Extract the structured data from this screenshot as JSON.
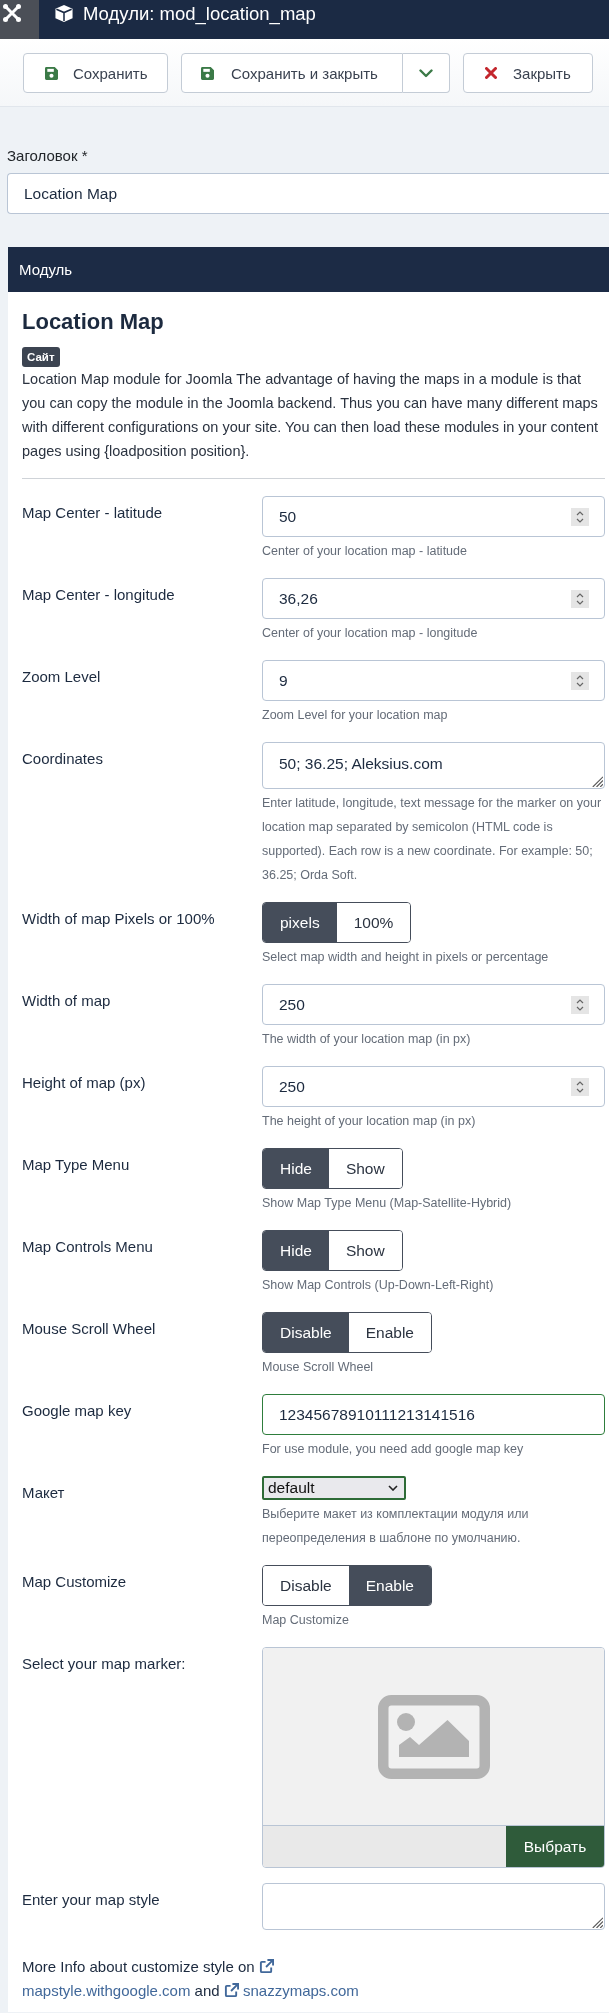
{
  "header": {
    "title": "Модули: mod_location_map"
  },
  "toolbar": {
    "buttons": [
      {
        "kind": "save",
        "label": "Сохранить"
      },
      {
        "kind": "save-split",
        "label": "Сохранить и закрыть"
      },
      {
        "kind": "close",
        "label": "Закрыть"
      }
    ]
  },
  "title_field": {
    "label": "Заголовок *",
    "value": "Location Map"
  },
  "panel": {
    "tabs": [
      {
        "label": "Модуль",
        "selected": true
      }
    ],
    "heading": "Location Map",
    "badge": "Сайт",
    "description": "Location Map module for Joomla The advantage of having the maps in a module is that you can copy the module in the Joomla backend. Thus you can have many different maps with different configurations on your site. You can then load these modules in your content pages using {loadposition position}."
  },
  "fields": [
    {
      "kind": "number",
      "label": "Map Center - latitude",
      "value": "50",
      "valid": false,
      "help": "Center of your location map - latitude"
    },
    {
      "kind": "number",
      "label": "Map Center - longitude",
      "value": "36,26",
      "valid": false,
      "help": "Center of your location map - longitude"
    },
    {
      "kind": "number",
      "label": "Zoom Level",
      "value": "9",
      "valid": false,
      "help": "Zoom Level for your location map"
    },
    {
      "kind": "textarea",
      "label": "Coordinates",
      "value": "50; 36.25; Aleksius.com",
      "valid": false,
      "help": "Enter latitude, longitude, text message for the marker on your location map separated by semicolon (HTML code is supported). Each row is a new coordinate. For example: 50; 36.25; Orda Soft."
    },
    {
      "kind": "toggle",
      "label": "Width of map Pixels or 100%",
      "options": [
        {
          "label": "pixels",
          "selected": true
        },
        {
          "label": "100%",
          "selected": false
        }
      ],
      "help": "Select map width and height in pixels or percentage"
    },
    {
      "kind": "number",
      "label": "Width of map",
      "value": "250",
      "valid": false,
      "help": "The width of your location map (in px)"
    },
    {
      "kind": "number",
      "label": "Height of map (px)",
      "value": "250",
      "valid": false,
      "help": "The height of your location map (in px)"
    },
    {
      "kind": "toggle",
      "label": "Map Type Menu",
      "options": [
        {
          "label": "Hide",
          "selected": true
        },
        {
          "label": "Show",
          "selected": false
        }
      ],
      "help": "Show Map Type Menu (Map-Satellite-Hybrid)"
    },
    {
      "kind": "toggle",
      "label": "Map Controls Menu",
      "options": [
        {
          "label": "Hide",
          "selected": true
        },
        {
          "label": "Show",
          "selected": false
        }
      ],
      "help": "Show Map Controls (Up-Down-Left-Right)"
    },
    {
      "kind": "toggle",
      "label": "Mouse Scroll Wheel",
      "options": [
        {
          "label": "Disable",
          "selected": true
        },
        {
          "label": "Enable",
          "selected": false
        }
      ],
      "help": "Mouse Scroll Wheel"
    },
    {
      "kind": "text",
      "label": "Google map key",
      "value": "12345678910111213141516",
      "valid": true,
      "help": "For use module, you need add google map key"
    },
    {
      "kind": "select",
      "label": "Макет",
      "value": "default",
      "valid": true,
      "help": "Выберите макет из комплектации модуля или переопределения в шаблоне по умолчанию."
    },
    {
      "kind": "toggle",
      "label": "Map Customize",
      "options": [
        {
          "label": "Disable",
          "selected": false
        },
        {
          "label": "Enable",
          "selected": true
        }
      ],
      "help": "Map Customize"
    },
    {
      "kind": "media",
      "label": "Select your map marker:",
      "button": "Выбрать"
    },
    {
      "kind": "textarea",
      "label": "Enter your map style",
      "valid": false
    }
  ],
  "more_info": {
    "parts": [
      {
        "kind": "text",
        "text": "More Info about customize style on"
      },
      {
        "kind": "link",
        "text": "mapstyle.withgoogle.com"
      },
      {
        "kind": "text",
        "text": "and"
      },
      {
        "kind": "link",
        "text": "snazzymaps.com"
      }
    ]
  }
}
